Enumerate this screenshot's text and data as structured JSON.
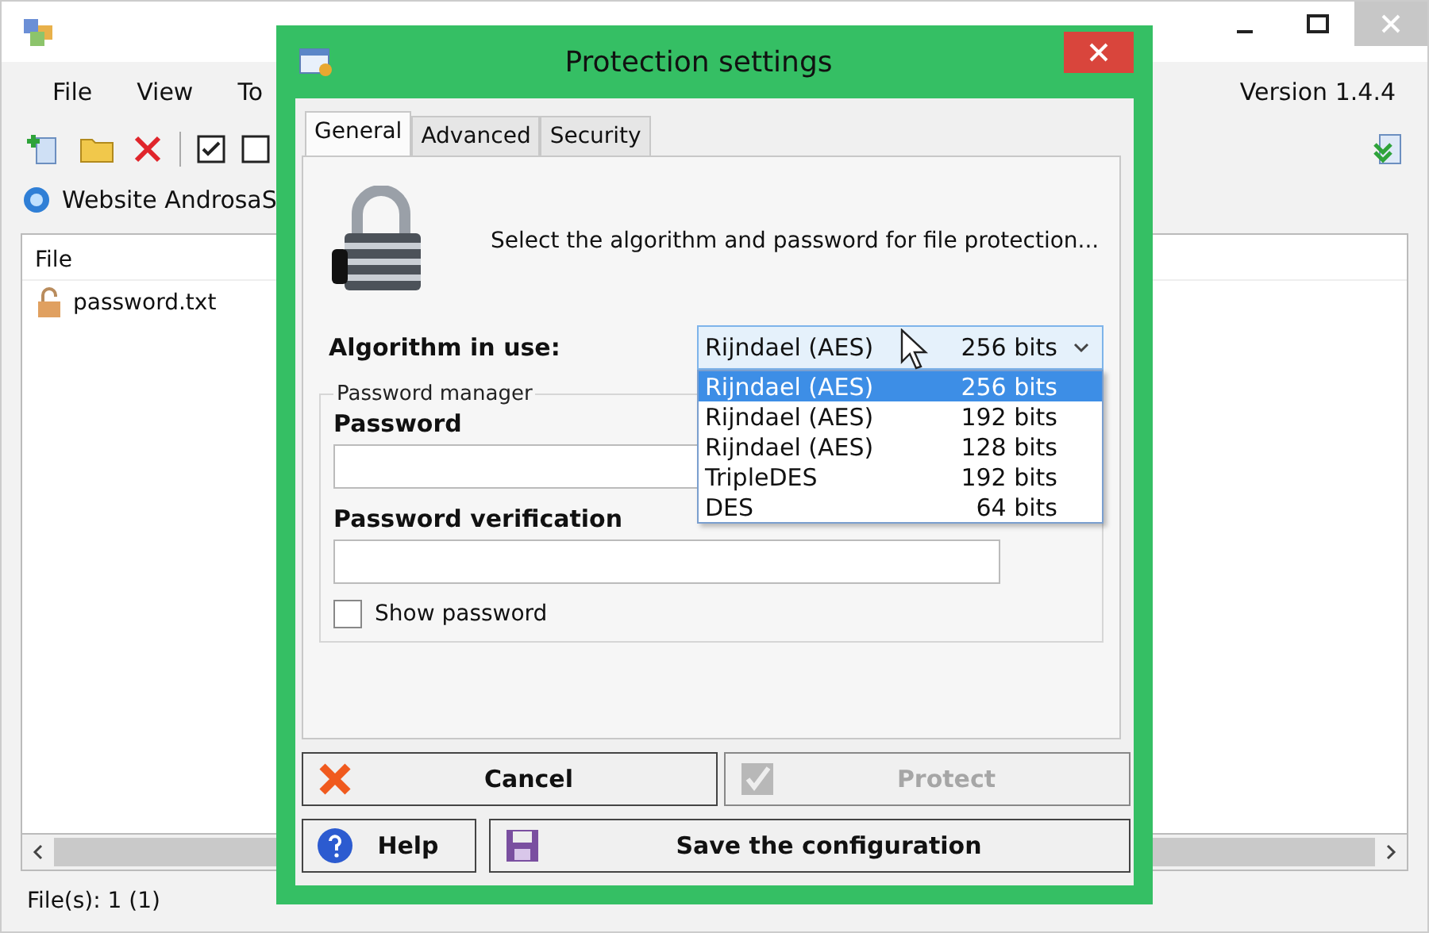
{
  "main_window": {
    "menu": [
      "File",
      "View",
      "To"
    ],
    "version": "Version 1.4.4",
    "link": "Website AndrosaS",
    "file_list": {
      "column": "File",
      "rows": [
        {
          "name": "password.txt",
          "locked": false
        }
      ]
    },
    "status_bar": "File(s): 1 (1)"
  },
  "dialog": {
    "title": "Protection settings",
    "tabs": [
      {
        "label": "General",
        "selected": true
      },
      {
        "label": "Advanced",
        "selected": false
      },
      {
        "label": "Security",
        "selected": false
      }
    ],
    "intro": "Select the algorithm and password for file protection...",
    "algorithm": {
      "label": "Algorithm in use:",
      "value_name": "Rijndael (AES)",
      "value_bits": "256 bits",
      "expanded": true,
      "options": [
        {
          "name": "Rijndael (AES)",
          "bits": "256 bits",
          "selected": true
        },
        {
          "name": "Rijndael (AES)",
          "bits": "192 bits",
          "selected": false
        },
        {
          "name": "Rijndael (AES)",
          "bits": "128 bits",
          "selected": false
        },
        {
          "name": "TripleDES",
          "bits": "192 bits",
          "selected": false
        },
        {
          "name": "DES",
          "bits": "64 bits",
          "selected": false
        }
      ]
    },
    "password_manager": {
      "legend": "Password manager",
      "password_label": "Password",
      "verification_label": "Password verification",
      "show_password": {
        "label": "Show password",
        "checked": false
      }
    },
    "buttons": [
      {
        "label": "Cancel",
        "kind": "cancel",
        "disabled": false
      },
      {
        "label": "Protect",
        "kind": "protect",
        "disabled": true
      },
      {
        "label": "Help",
        "kind": "help",
        "disabled": false
      },
      {
        "label": "Save the configuration",
        "kind": "save",
        "disabled": false
      }
    ]
  }
}
